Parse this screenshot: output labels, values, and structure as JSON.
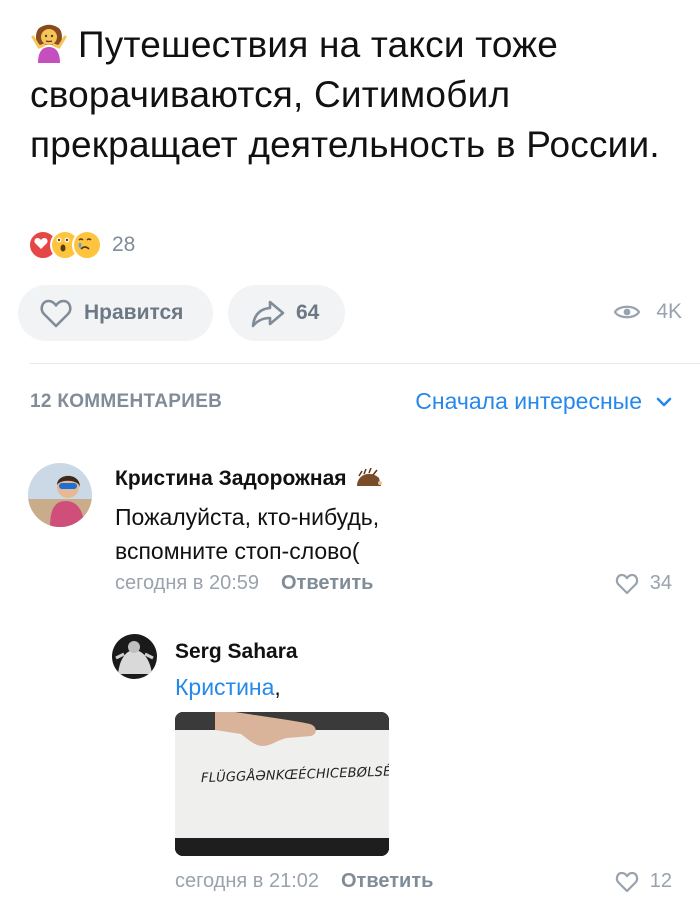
{
  "post": {
    "title": "Путешествия на такси тоже сворачиваются, Ситимобил прекращает деятельность в России.",
    "emoji_icon": "person-shrugging-icon",
    "reactions_count": "28",
    "reactions_icons": [
      "heart-reaction-icon",
      "wow-reaction-icon",
      "cry-reaction-icon"
    ]
  },
  "actions": {
    "like_label": "Нравится",
    "share_count": "64",
    "views_count": "4K"
  },
  "comments_header": {
    "count_label": "12 КОММЕНТАРИЕВ",
    "sort_label": "Сначала интересные"
  },
  "comments": [
    {
      "author": "Кристина Задорожная",
      "badge_icon": "hedgehog-icon",
      "text": "Пожалуйста, кто-нибудь, вспомните стоп-слово(",
      "time": "сегодня в 20:59",
      "reply_label": "Ответить",
      "likes": "34"
    },
    {
      "author": "Serg Sahara",
      "mention": "Кристина",
      "mention_suffix": ",",
      "attachment_text": "FLÜGGÅƏNKŒÉCHICEBØLSÉN",
      "time": "сегодня в 21:02",
      "reply_label": "Ответить",
      "likes": "12"
    }
  ],
  "colors": {
    "accent": "#2688eb",
    "secondary_text": "#818c99",
    "button_bg": "#f2f3f5",
    "divider": "#e7e8ec"
  }
}
